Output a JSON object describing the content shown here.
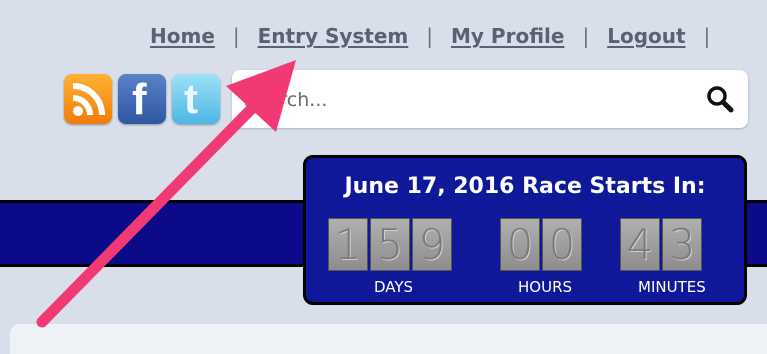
{
  "nav": {
    "home": "Home",
    "entry_system": "Entry System",
    "my_profile": "My Profile",
    "logout": "Logout",
    "separator": "|"
  },
  "social": {
    "fb_glyph": "f",
    "tw_glyph": "t"
  },
  "search": {
    "placeholder": "Search..."
  },
  "countdown": {
    "title": "June 17, 2016 Race Starts In:",
    "days": [
      "1",
      "5",
      "9"
    ],
    "hours": [
      "0",
      "0"
    ],
    "minutes": [
      "4",
      "3"
    ],
    "days_label": "DAYS",
    "hours_label": "HOURS",
    "minutes_label": "MINUTES"
  },
  "colors": {
    "banner": "#0b0b8a",
    "countdown_bg": "#10189a",
    "annotation_arrow": "#f13a74"
  }
}
